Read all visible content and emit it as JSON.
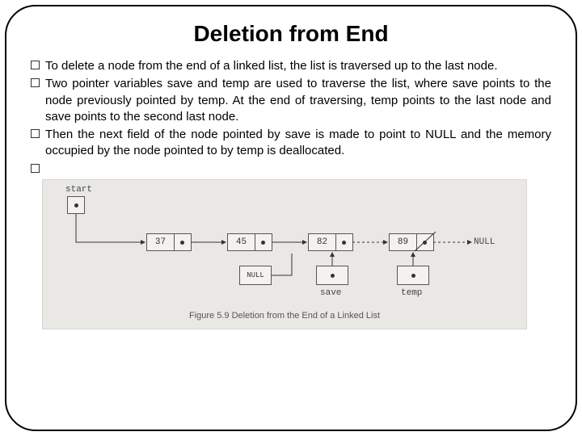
{
  "title": "Deletion from End",
  "bullets": [
    "To delete a node from the end of a linked list, the list is traversed up to the last node.",
    "Two pointer variables save and temp are used to traverse the list, where save points to the node previously pointed by temp. At the end of traversing, temp points to the last node and save points to the second last node.",
    "Then the next field of the node pointed by save is made to point to NULL and the memory occupied by the node pointed to by temp is deallocated."
  ],
  "diagram": {
    "start_label": "start",
    "null_label": "NULL",
    "null_inside": "NULL",
    "save_label": "save",
    "temp_label": "temp",
    "caption": "Figure 5.9 Deletion from the End of a Linked List",
    "nodes": [
      "37",
      "45",
      "82",
      "89"
    ]
  }
}
